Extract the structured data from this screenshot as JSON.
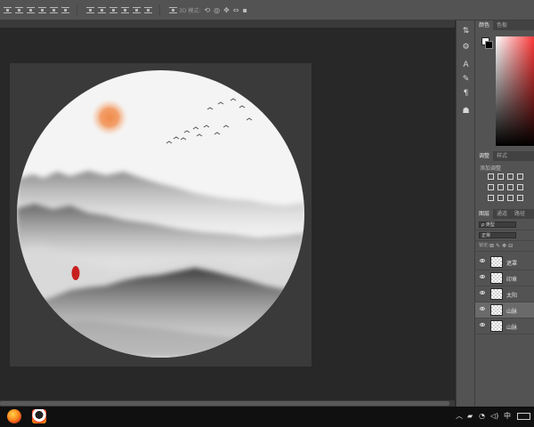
{
  "options_bar": {
    "mode_label": "3D 模式:",
    "icon_names": [
      "align-top-icon",
      "align-vcenter-icon",
      "align-bottom-icon",
      "align-left-icon",
      "align-hcenter-icon",
      "align-right-icon",
      "distribute-top-icon",
      "distribute-vcenter-icon",
      "distribute-bottom-icon",
      "distribute-left-icon",
      "distribute-hcenter-icon",
      "distribute-right-icon"
    ]
  },
  "panels": {
    "color_tabs": [
      "颜色",
      "色板"
    ],
    "adjust_tabs": [
      "调整",
      "样式"
    ],
    "adjust_title": "添加调整",
    "layer_tabs": [
      "图层",
      "通道",
      "路径"
    ],
    "filter_kind": "ρ 类型",
    "blend_mode": "正常",
    "lock_label": "锁定:",
    "layers": [
      {
        "name": "遮罩",
        "visible": true,
        "selected": false
      },
      {
        "name": "印章",
        "visible": true,
        "selected": false
      },
      {
        "name": "太阳",
        "visible": true,
        "selected": false
      },
      {
        "name": "山脉",
        "visible": true,
        "selected": true
      },
      {
        "name": "山脉",
        "visible": true,
        "selected": false
      }
    ]
  },
  "colors": {
    "foreground": "#ffffff",
    "background": "#000000",
    "sun": "#f08a4a",
    "seal": "#c8201e"
  },
  "taskbar": {
    "apps": [
      "firefox-icon",
      "qq-icon"
    ]
  }
}
